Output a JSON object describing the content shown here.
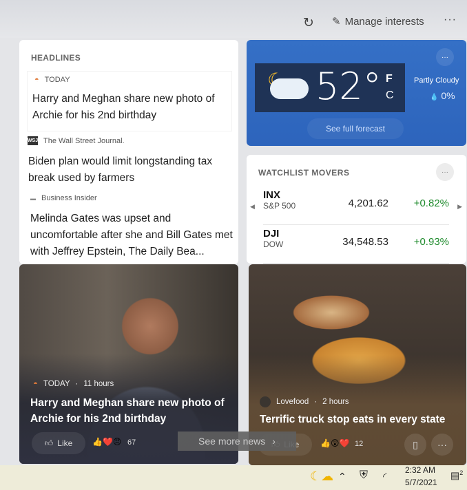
{
  "toolbar": {
    "refresh_icon": "refresh-icon",
    "manage_label": "Manage interests",
    "more_label": "···"
  },
  "headlines": {
    "title": "HEADLINES",
    "items": [
      {
        "source": "TODAY",
        "title": "Harry and Meghan share new photo of Archie for his 2nd birthday"
      },
      {
        "source": "The Wall Street Journal.",
        "logo": "WSJ",
        "title": "Biden plan would limit longstanding tax break used by farmers"
      },
      {
        "source": "Business Insider",
        "title": "Melinda Gates was upset and uncomfortable after she and Bill Gates met with Jeffrey Epstein, The Daily Bea..."
      }
    ]
  },
  "weather": {
    "temp": "52°",
    "unit_f": "F",
    "unit_c": "C",
    "condition": "Partly Cloudy",
    "precip": "0%",
    "forecast_label": "See full forecast",
    "more": "···",
    "accent": "#2f6cc7"
  },
  "watchlist": {
    "title": "WATCHLIST MOVERS",
    "more": "···",
    "rows": [
      {
        "symbol": "INX",
        "name": "S&P 500",
        "value": "4,201.62",
        "change": "+0.82%"
      },
      {
        "symbol": "DJI",
        "name": "DOW",
        "value": "34,548.53",
        "change": "+0.93%"
      }
    ],
    "positive_color": "#1d8a2b"
  },
  "cards": [
    {
      "source": "TODAY",
      "time": "11 hours",
      "title": "Harry and Meghan share new photo of Archie for his 2nd birthday",
      "like_label": "Like",
      "reactions": "👍❤️😠",
      "count": "67"
    },
    {
      "source": "Lovefood",
      "time": "2 hours",
      "title": "Terrific truck stop eats in every state",
      "like_label": "Like",
      "reactions": "👍😲❤️",
      "count": "12"
    }
  ],
  "see_more": "See more news",
  "taskbar": {
    "time": "2:32 AM",
    "date": "5/7/2021",
    "notifications": "2"
  }
}
